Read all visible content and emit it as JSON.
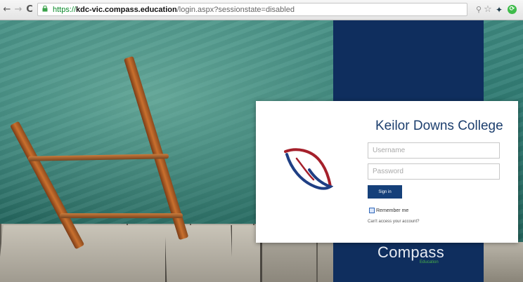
{
  "browser": {
    "url_scheme": "https://",
    "url_host": "kdc-vic.compass.education",
    "url_path": "/login.aspx?sessionstate=disabled",
    "back_icon": "←",
    "forward_icon": "→",
    "reload_icon": "C",
    "pin_icon": "⚲",
    "star_icon": "☆",
    "bird_icon": "✦",
    "green_icon": "⟳"
  },
  "login": {
    "title": "Keilor Downs College",
    "username_placeholder": "Username",
    "password_placeholder": "Password",
    "signin_label": "Sign in",
    "remember_label": "Remember me",
    "cant_access_label": "Can't access your account?"
  },
  "brand": {
    "name": "Compass",
    "sub": "Education"
  },
  "colors": {
    "navy": "#0f2e5e",
    "button": "#15407a",
    "title": "#1d3f6e",
    "brand_green": "#49b24a",
    "logo_red": "#a5202b",
    "logo_blue": "#1f3f84"
  }
}
